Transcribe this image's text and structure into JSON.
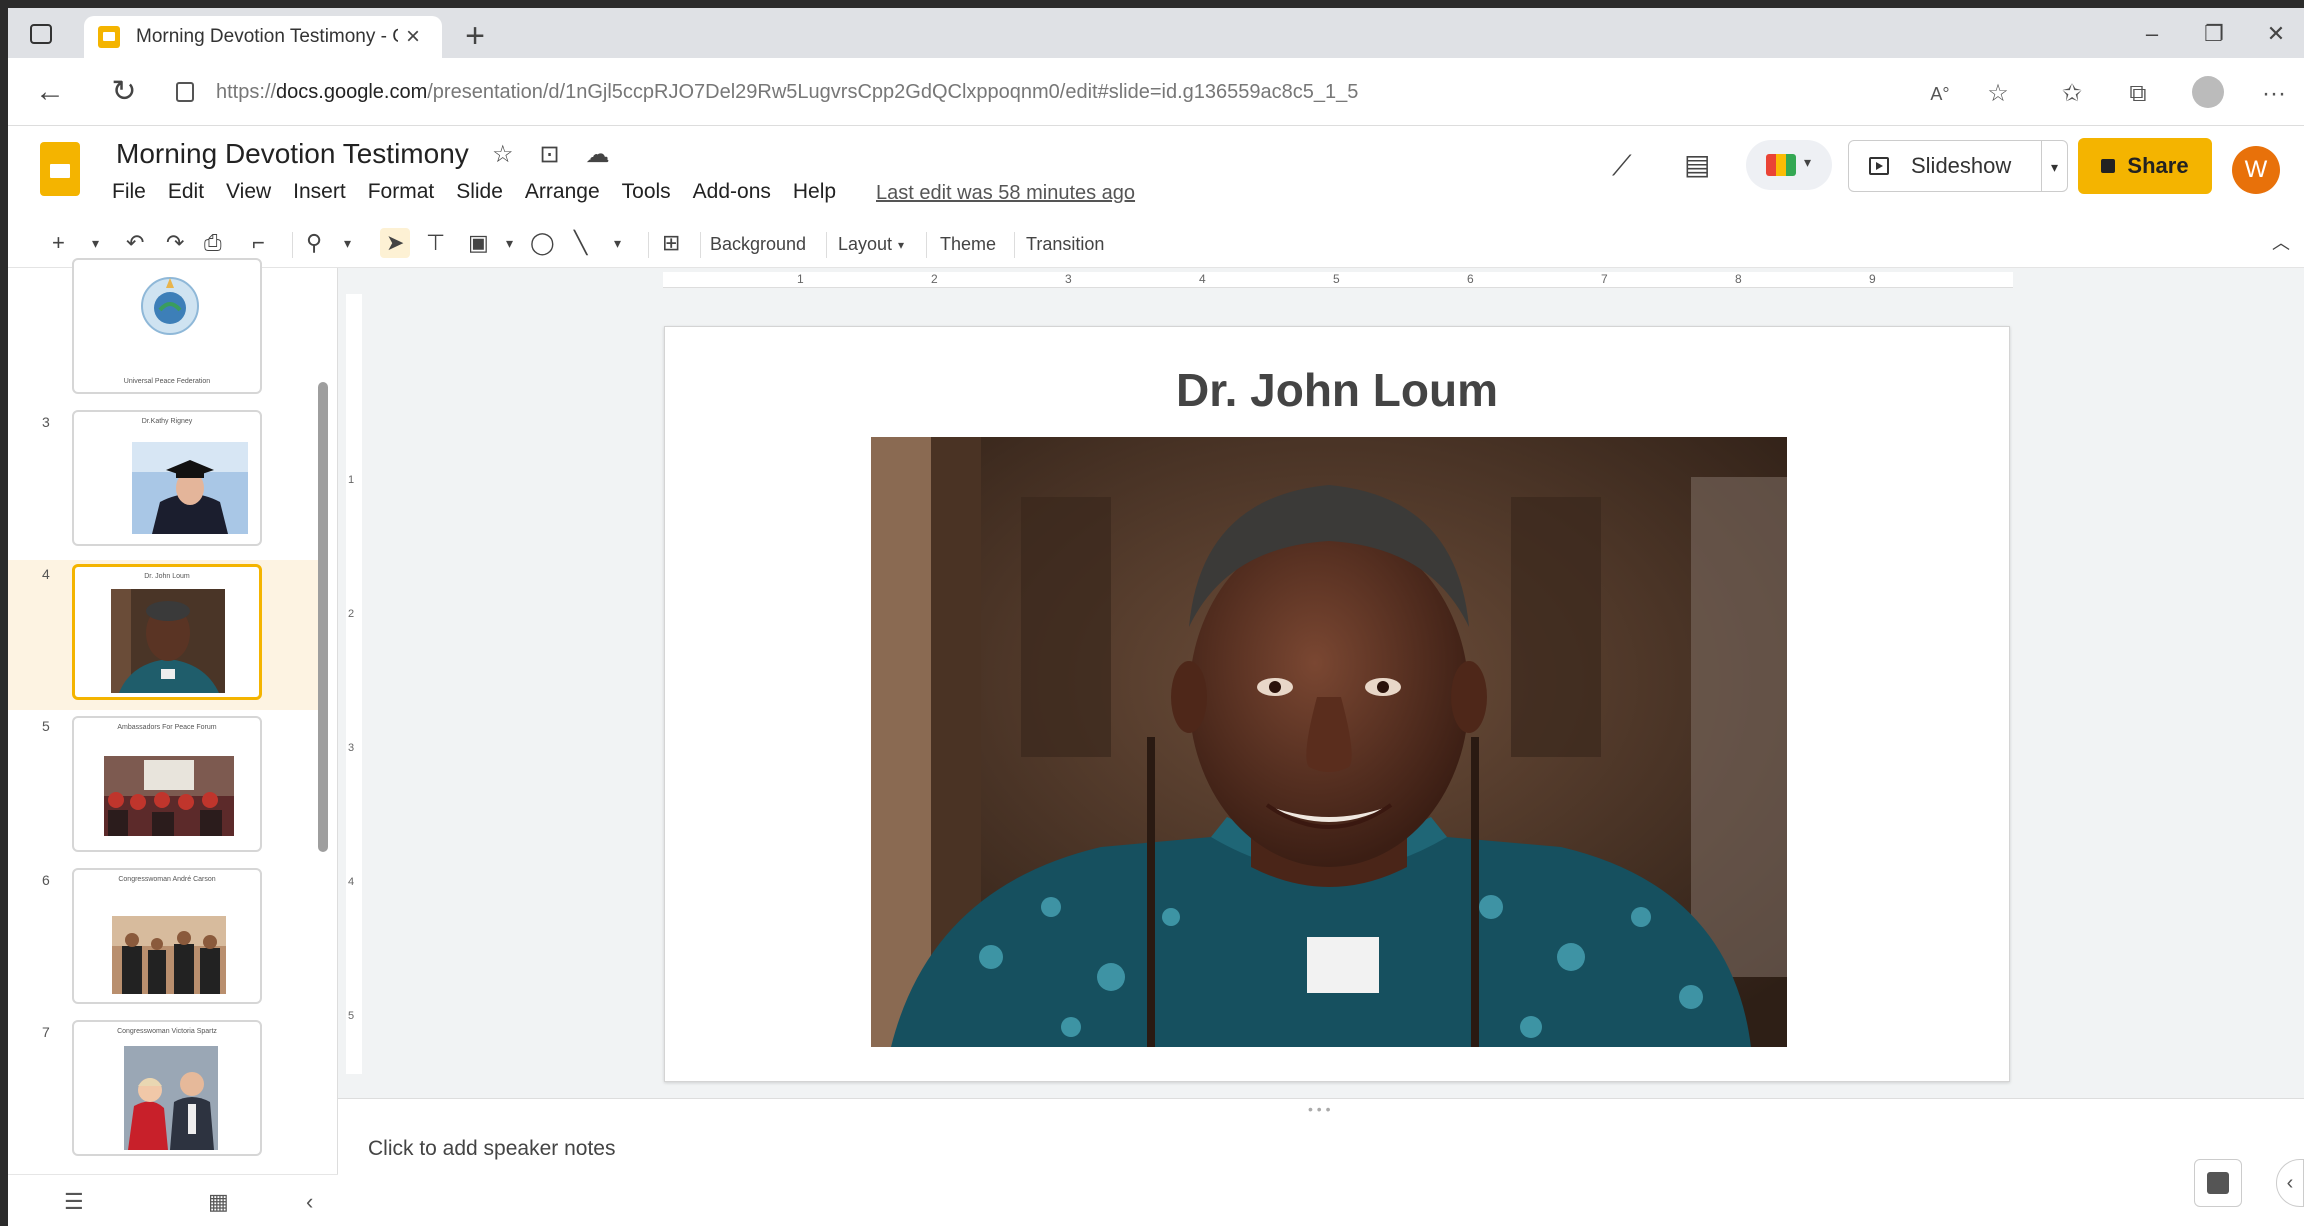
{
  "browser": {
    "tab_title": "Morning Devotion Testimony - G",
    "new_tab": "+",
    "url_prefix": "https://",
    "url_domain": "docs.google.com",
    "url_path": "/presentation/d/1nGjl5ccpRJO7Del29Rw5LugvrsCpp2GdQClxppoqnm0/edit#slide=id.g136559ac8c5_1_5",
    "read_aloud": "A°",
    "more": "···"
  },
  "app": {
    "title": "Morning Devotion Testimony",
    "menu": [
      "File",
      "Edit",
      "View",
      "Insert",
      "Format",
      "Slide",
      "Arrange",
      "Tools",
      "Add-ons",
      "Help"
    ],
    "last_edit": "Last edit was 58 minutes ago",
    "slideshow_label": "Slideshow",
    "share_label": "Share",
    "user_initial": "W"
  },
  "toolbar": {
    "background": "Background",
    "layout": "Layout",
    "theme": "Theme",
    "transition": "Transition"
  },
  "filmstrip": {
    "slides": [
      {
        "num": "",
        "caption": "Universal Peace Federation"
      },
      {
        "num": "3",
        "caption": "Dr.Kathy Rigney"
      },
      {
        "num": "4",
        "caption": "Dr. John Loum"
      },
      {
        "num": "5",
        "caption": "Ambassadors For Peace Forum"
      },
      {
        "num": "6",
        "caption": "Congresswoman André Carson"
      },
      {
        "num": "7",
        "caption": "Congresswoman Victoria Spartz"
      }
    ],
    "active_index": 2
  },
  "ruler": {
    "h_marks": [
      "1",
      "2",
      "3",
      "4",
      "5",
      "6",
      "7",
      "8",
      "9"
    ],
    "v_marks": [
      "1",
      "2",
      "3",
      "4",
      "5"
    ]
  },
  "slide": {
    "title": "Dr. John Loum"
  },
  "notes": {
    "placeholder": "Click to add speaker notes"
  },
  "colors": {
    "accent": "#f4b400",
    "user_avatar": "#e8710a"
  }
}
